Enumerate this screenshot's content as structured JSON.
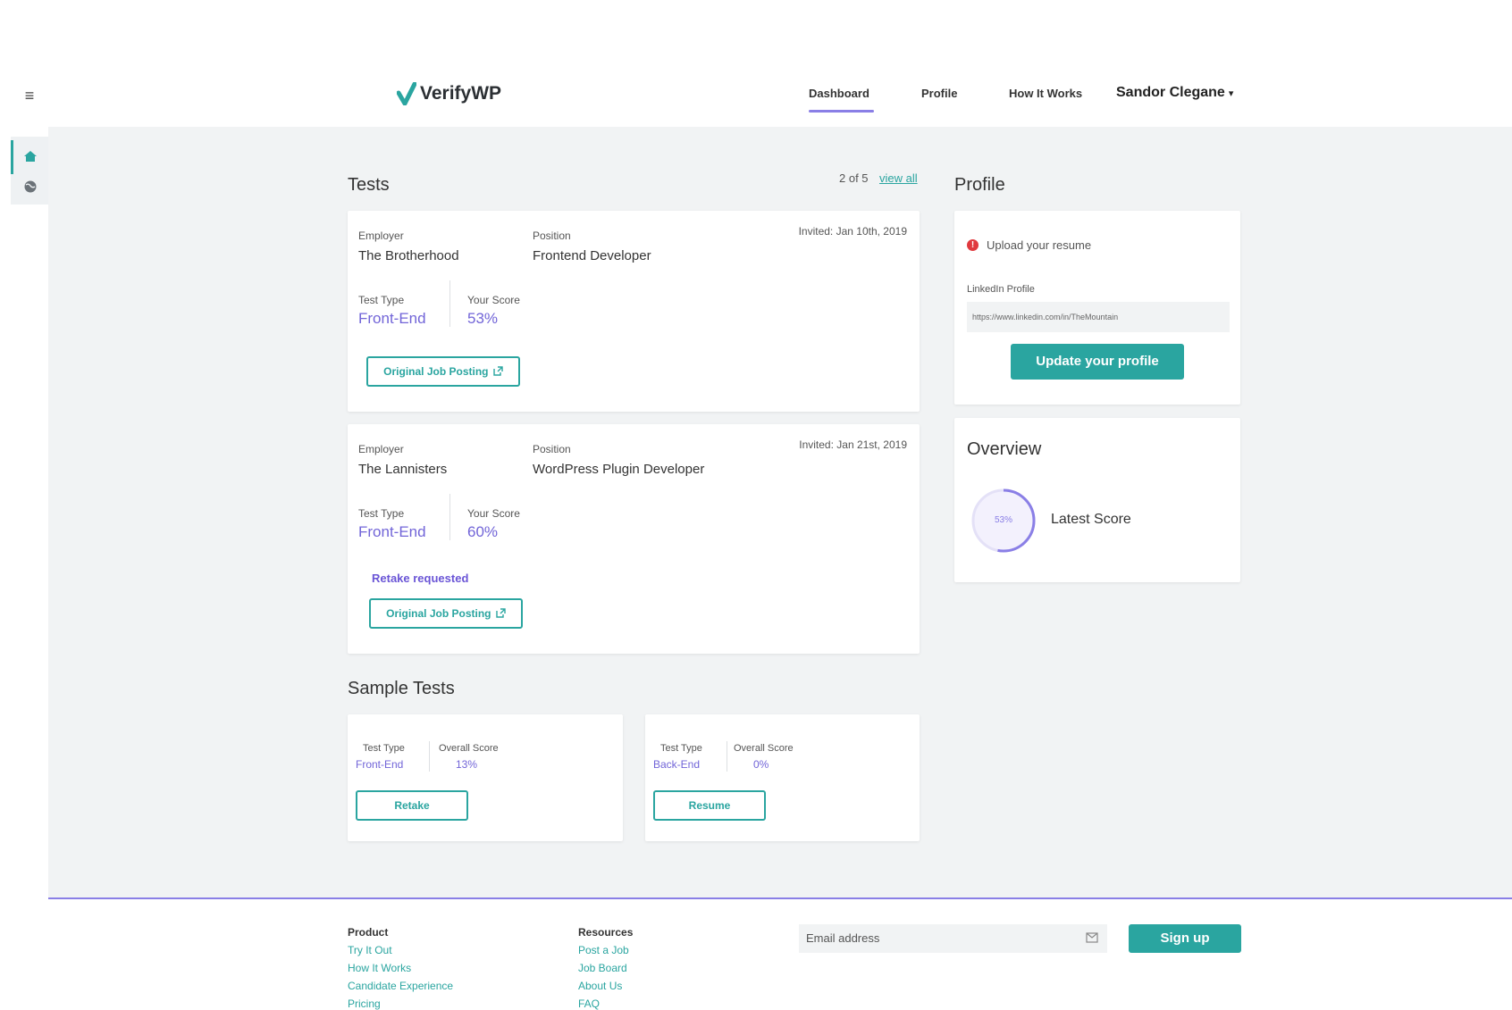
{
  "app": {
    "brand": "VerifyWP",
    "accent_color": "#2aa5a0",
    "highlight_color": "#7265d8"
  },
  "header": {
    "nav": [
      "Dashboard",
      "Profile",
      "How It Works"
    ],
    "active_nav": "Dashboard",
    "user_name": "Sandor Clegane",
    "user_caret": "▾"
  },
  "left_rail": {
    "menu_icon": "hamburger-icon",
    "items": [
      "home-icon",
      "globe-icon"
    ]
  },
  "tests": {
    "title": "Tests",
    "counter": "2 of 5",
    "view_all": "view all",
    "cards": [
      {
        "employer_label": "Employer",
        "employer": "The Brotherhood",
        "position_label": "Position",
        "position": "Frontend Developer",
        "invited": "Invited: Jan 10th, 2019",
        "test_type_label": "Test Type",
        "test_type": "Front-End",
        "score_label": "Your Score",
        "score": "53%",
        "button": "Original Job Posting"
      },
      {
        "employer_label": "Employer",
        "employer": "The Lannisters",
        "position_label": "Position",
        "position": "WordPress Plugin Developer",
        "invited": "Invited: Jan 21st, 2019",
        "test_type_label": "Test Type",
        "test_type": "Front-End",
        "score_label": "Your Score",
        "score": "60%",
        "status": "Retake requested",
        "button": "Original Job Posting"
      }
    ]
  },
  "profile": {
    "title": "Profile",
    "alert": "Upload your resume",
    "linkedin_label": "LinkedIn Profile",
    "linkedin_value": "https://www.linkedin.com/in/TheMountain",
    "update_button": "Update your profile"
  },
  "overview": {
    "title": "Overview",
    "score_text": "53%",
    "score_fraction": 0.53,
    "label": "Latest Score"
  },
  "sample_tests": {
    "title": "Sample Tests",
    "cards": [
      {
        "type_label": "Test Type",
        "type": "Front-End",
        "score_label": "Overall Score",
        "score": "13%",
        "button": "Retake"
      },
      {
        "type_label": "Test Type",
        "type": "Back-End",
        "score_label": "Overall Score",
        "score": "0%",
        "button": "Resume"
      }
    ]
  },
  "footer": {
    "product_title": "Product",
    "product_links": [
      "Try It Out",
      "How It Works",
      "Candidate Experience",
      "Pricing"
    ],
    "resources_title": "Resources",
    "resources_links": [
      "Post a Job",
      "Job Board",
      "About Us",
      "FAQ"
    ],
    "email_placeholder": "Email address",
    "signup_button": "Sign up"
  }
}
